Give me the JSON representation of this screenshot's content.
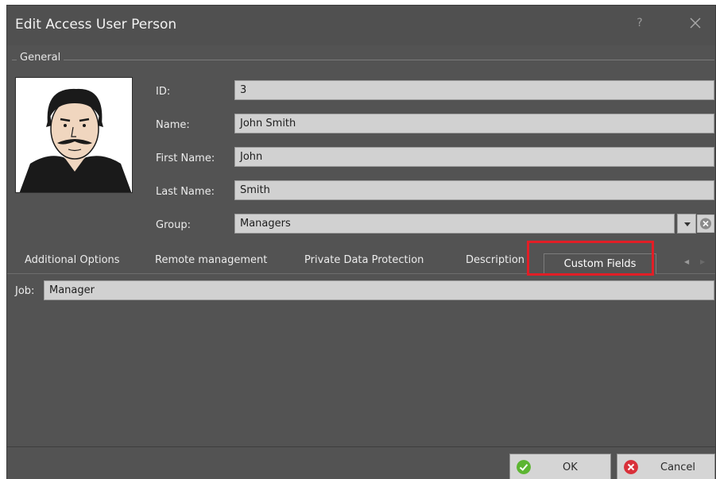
{
  "dialog": {
    "title": "Edit Access User Person",
    "help_label": "?"
  },
  "general": {
    "legend": "General",
    "fields": {
      "id": {
        "label": "ID:",
        "value": "3"
      },
      "name": {
        "label": "Name:",
        "value": "John Smith"
      },
      "first_name": {
        "label": "First Name:",
        "value": "John"
      },
      "last_name": {
        "label": "Last Name:",
        "value": "Smith"
      },
      "group": {
        "label": "Group:",
        "value": "Managers"
      }
    }
  },
  "tabs": [
    {
      "label": "Additional Options",
      "active": false
    },
    {
      "label": "Remote management",
      "active": false
    },
    {
      "label": "Private Data Protection",
      "active": false
    },
    {
      "label": "Description",
      "active": false
    },
    {
      "label": "Custom Fields",
      "active": true
    }
  ],
  "custom_fields": {
    "job": {
      "label": "Job:",
      "value": "Manager"
    }
  },
  "buttons": {
    "ok": "OK",
    "cancel": "Cancel"
  },
  "colors": {
    "window_bg": "#535353",
    "input_bg": "#d1d1d1",
    "highlight": "#e21e26",
    "ok_icon": "#5cb531",
    "cancel_icon": "#d9303a"
  },
  "icons": {
    "close": "close-icon",
    "help": "help-icon",
    "dropdown": "chevron-down-icon",
    "clear": "clear-icon",
    "ok": "checkmark-icon",
    "cancel": "cancel-icon"
  }
}
